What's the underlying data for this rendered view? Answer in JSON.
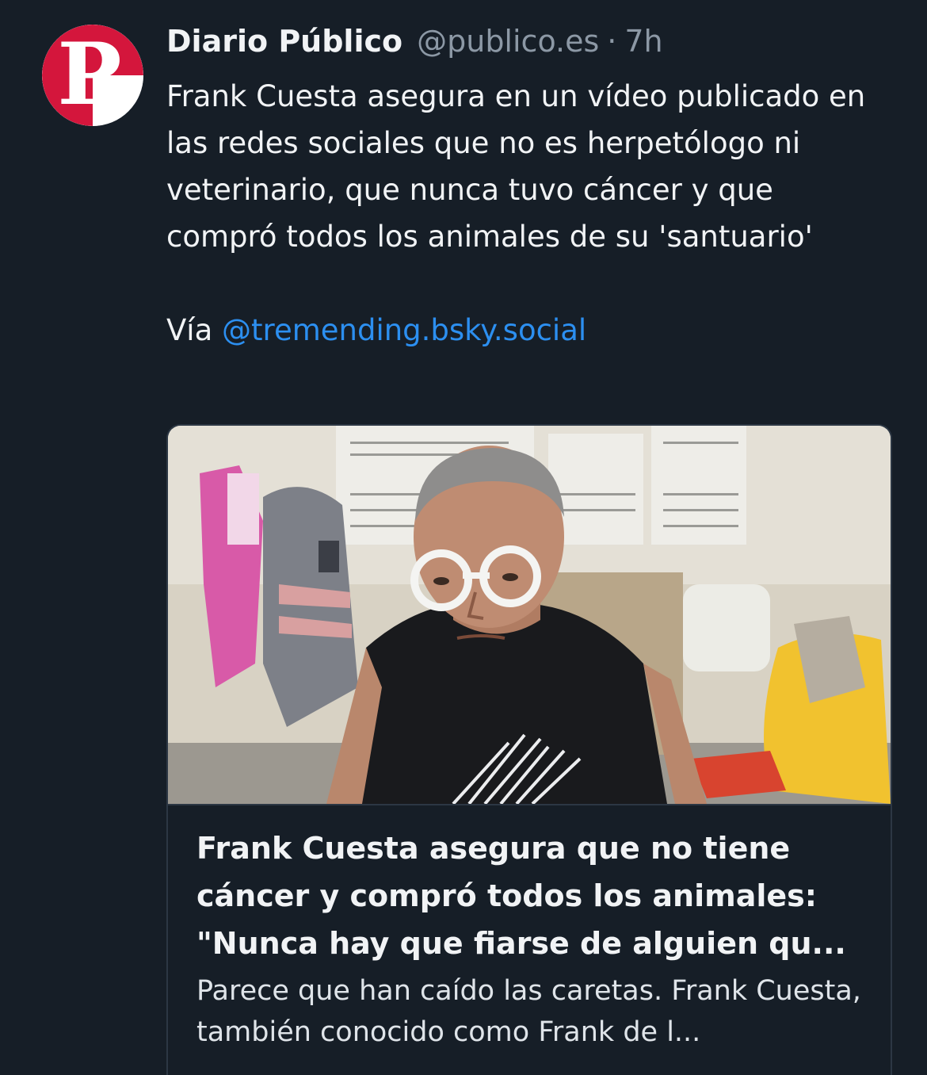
{
  "post": {
    "author_name": "Diario Público",
    "handle": "@publico.es",
    "separator": "·",
    "time": "7h",
    "avatar_icon": "publico-logo-icon",
    "text": "Frank Cuesta asegura en un vídeo publicado en las redes sociales que no es herpetólogo ni veterinario, que nunca tuvo cáncer y que compró todos los animales de su 'santuario'",
    "via_prefix": "Vía",
    "via_mention": "@tremending.bsky.social"
  },
  "embed": {
    "title": "Frank Cuesta asegura que no tiene cáncer y compró todos los animales: \"Nunca hay que fiarse de alguien qu...",
    "description": "Parece que han caído las caretas. Frank Cuesta, también conocido como Frank de l...",
    "image_icon": "article-thumbnail-photo"
  },
  "colors": {
    "background": "#161e27",
    "text": "#f1f3f5",
    "muted": "#8c98a5",
    "link": "#2c8ff0",
    "border": "#2c3744",
    "brand_red": "#d4163c"
  }
}
